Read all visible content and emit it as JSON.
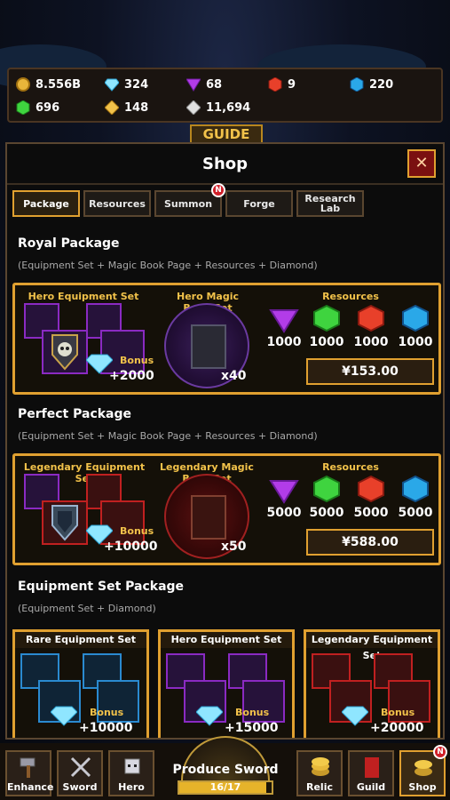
{
  "resources": {
    "gold": "8.556B",
    "diamond": "324",
    "purple_gem": "68",
    "red_gem": "9",
    "blue_gem": "220",
    "green_gem": "696",
    "yellow_gem": "148",
    "silver": "11,694"
  },
  "guide_tab": "GUIDE",
  "shop": {
    "title": "Shop",
    "close_glyph": "✕",
    "tabs": [
      {
        "label": "Package",
        "active": true
      },
      {
        "label": "Resources",
        "active": false
      },
      {
        "label": "Summon",
        "active": false,
        "badge": "N"
      },
      {
        "label": "Forge",
        "active": false
      },
      {
        "label": "Research Lab",
        "active": false
      }
    ]
  },
  "royal": {
    "title": "Royal Package",
    "subtitle": "(Equipment Set + Magic Book Page + Resources + Diamond)",
    "equip_label": "Hero Equipment Set",
    "book_label": "Hero Magic Book Set",
    "resources_label": "Resources",
    "bonus_label": "Bonus",
    "bonus_value": "+2000",
    "book_count": "x40",
    "gems": [
      "1000",
      "1000",
      "1000",
      "1000"
    ],
    "price": "¥153.00"
  },
  "perfect": {
    "title": "Perfect Package",
    "subtitle": "(Equipment Set + Magic Book Page + Resources + Diamond)",
    "equip_label": "Legendary Equipment Set",
    "book_label": "Legendary Magic Book Set",
    "resources_label": "Resources",
    "bonus_label": "Bonus",
    "bonus_value": "+10000",
    "book_count": "x50",
    "gems": [
      "5000",
      "5000",
      "5000",
      "5000"
    ],
    "price": "¥588.00"
  },
  "equipment_set": {
    "title": "Equipment Set Package",
    "subtitle": "(Equipment Set + Diamond)",
    "cards": [
      {
        "label": "Rare Equipment Set",
        "bonus_label": "Bonus",
        "bonus_value": "+10000"
      },
      {
        "label": "Hero Equipment Set",
        "bonus_label": "Bonus",
        "bonus_value": "+15000"
      },
      {
        "label": "Legendary Equipment Set",
        "bonus_label": "Bonus",
        "bonus_value": "+20000"
      }
    ]
  },
  "nav": {
    "enhance": "Enhance",
    "sword": "Sword",
    "hero": "Hero",
    "produce_title": "Produce Sword",
    "produce_progress": "16/17",
    "produce_fraction": 0.94,
    "relic": "Relic",
    "guild": "Guild",
    "shop": "Shop",
    "shop_badge": "N"
  },
  "colors": {
    "accent_gold": "#e0a030",
    "purple": "#b23ce8",
    "green": "#3fd43f",
    "red": "#e8402a",
    "blue": "#2aa8e8"
  }
}
